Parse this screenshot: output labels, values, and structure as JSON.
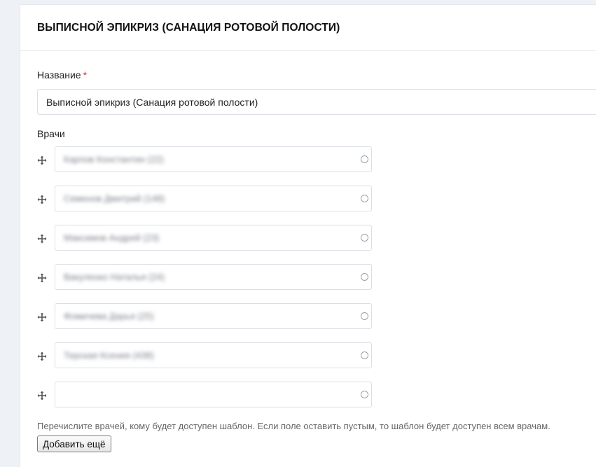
{
  "form": {
    "title": "ВЫПИСНОЙ ЭПИКРИЗ (САНАЦИЯ РОТОВОЙ ПОЛОСТИ)",
    "name_label": "Название",
    "required_mark": "*",
    "name_value": "Выписной эпикриз (Санация ротовой полости)",
    "doctors_label": "Врачи",
    "doctors": [
      {
        "value": "Карпов Константин (22)"
      },
      {
        "value": "Семенов Дмитрий (148)"
      },
      {
        "value": "Максимов Андрей (23)"
      },
      {
        "value": "Вакуленко Наталья (24)"
      },
      {
        "value": "Фомичева Дарья (25)"
      },
      {
        "value": "Терская Ксения (438)"
      },
      {
        "value": ""
      }
    ],
    "help_text": "Перечислите врачей, кому будет доступен шаблон. Если поле оставить пустым, то шаблон будет доступен всем врачам.",
    "add_button_label": "Добавить ещё"
  },
  "icons": {
    "drag": "drag-move-icon",
    "clear": "clear-circle-icon"
  },
  "colors": {
    "page_background": "#eef1f6",
    "required": "#d9342b",
    "border": "#dcdfe6"
  }
}
